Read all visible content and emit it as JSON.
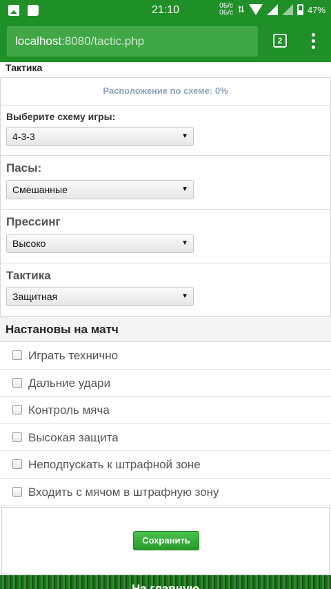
{
  "status_bar": {
    "time": "21:10",
    "data_rate_top": "0Б/с",
    "data_rate_bottom": "0Б/с",
    "data_arrows": "⇅",
    "battery": "47%",
    "color": "#1f8f27"
  },
  "browser": {
    "url_host": "localhost",
    "url_rest": ":8080/tactic.php",
    "tab_count": "2"
  },
  "page": {
    "title": "Тактика",
    "status_text": "Расположение по схеме: 0%",
    "formation": {
      "label": "Выберите схему игры:",
      "value": "4-3-3"
    },
    "passing": {
      "label": "Пасы:",
      "value": "Смешанные"
    },
    "pressing": {
      "label": "Прессинг",
      "value": "Высоко"
    },
    "tactic": {
      "label": "Тактика",
      "value": "Защитная"
    },
    "dropdown_arrow": "▼",
    "instructions": {
      "header": "Настановы на матч",
      "items": [
        {
          "label": "Играть технично",
          "checked": false
        },
        {
          "label": "Дальние удари",
          "checked": false
        },
        {
          "label": "Контроль мяча",
          "checked": false
        },
        {
          "label": "Высокая защита",
          "checked": false
        },
        {
          "label": "Неподпускать к штрафной зоне",
          "checked": false
        },
        {
          "label": "Входить с мячом в штрафную зону",
          "checked": false
        }
      ]
    },
    "save_button": "Сохранить",
    "footer_link": "На главную"
  }
}
